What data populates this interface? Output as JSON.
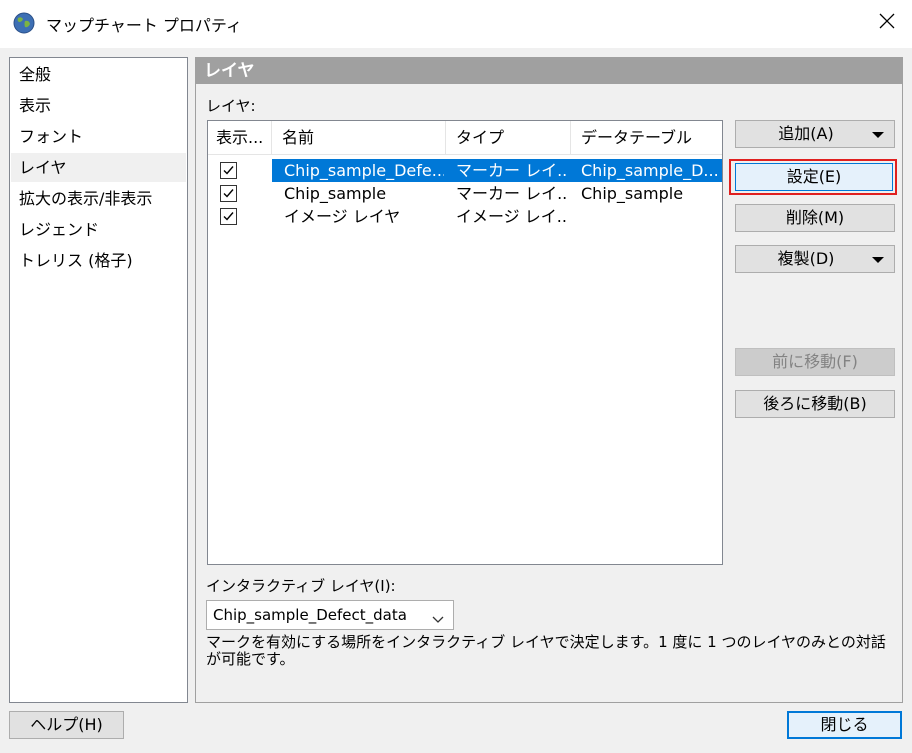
{
  "window": {
    "title": "マップチャート プロパティ",
    "icon": "globe-icon",
    "close_icon": "close-icon"
  },
  "nav": {
    "items": [
      {
        "label": "全般",
        "selected": false
      },
      {
        "label": "表示",
        "selected": false
      },
      {
        "label": "フォント",
        "selected": false
      },
      {
        "label": "レイヤ",
        "selected": true
      },
      {
        "label": "拡大の表示/非表示",
        "selected": false
      },
      {
        "label": "レジェンド",
        "selected": false
      },
      {
        "label": "トレリス (格子)",
        "selected": false
      }
    ]
  },
  "panel": {
    "header": "レイヤ",
    "layer_label": "レイヤ:",
    "columns": [
      "表示...",
      "名前",
      "タイプ",
      "データテーブル"
    ],
    "rows": [
      {
        "checked": true,
        "name": "Chip_sample_Defe...",
        "type": "マーカー レイ...",
        "table": "Chip_sample_D...",
        "selected": true
      },
      {
        "checked": true,
        "name": "Chip_sample",
        "type": "マーカー レイ...",
        "table": "Chip_sample",
        "selected": false
      },
      {
        "checked": true,
        "name": "イメージ レイヤ",
        "type": "イメージ レイ...",
        "table": "",
        "selected": false
      }
    ],
    "buttons": {
      "add": "追加(A)",
      "settings": "設定(E)",
      "delete": "削除(M)",
      "duplicate": "複製(D)",
      "move_up": "前に移動(F)",
      "move_down": "後ろに移動(B)"
    },
    "interactive_label": "インタラクティブ レイヤ(I):",
    "interactive_value": "Chip_sample_Defect_data",
    "description": "マークを有効にする場所をインタラクティブ レイヤで決定します。1 度に 1 つのレイヤのみとの対話が可能です。"
  },
  "footer": {
    "help": "ヘルプ(H)",
    "close": "閉じる"
  },
  "colors": {
    "selection": "#0078d7",
    "highlight": "#e0201f",
    "panel_header": "#a0a0a0"
  }
}
